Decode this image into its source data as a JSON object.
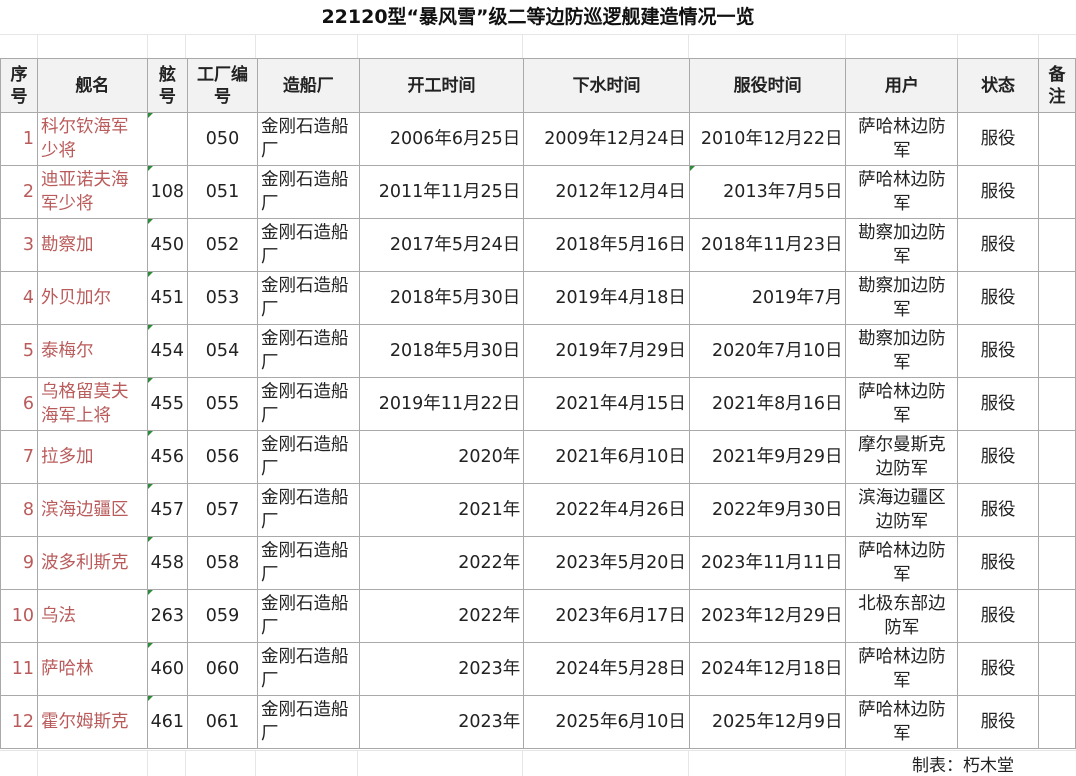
{
  "title": "22120型“暴风雪”级二等边防巡逻舰建造情况一览",
  "columns": [
    "序号",
    "舰名",
    "舷号",
    "工厂编号",
    "造船厂",
    "开工时间",
    "下水时间",
    "服役时间",
    "用户",
    "状态",
    "备注"
  ],
  "rows": [
    {
      "idx": "1",
      "name": "科尔钦海军少将",
      "hull": "",
      "factory": "050",
      "yard": "金刚石造船厂",
      "laid": "2006年6月25日",
      "launched": "2009年12月24日",
      "commissioned": "2010年12月22日",
      "user": "萨哈林边防军",
      "status": "服役",
      "note": ""
    },
    {
      "idx": "2",
      "name": "迪亚诺夫海军少将",
      "hull": "108",
      "factory": "051",
      "yard": "金刚石造船厂",
      "laid": "2011年11月25日",
      "launched": "2012年12月4日",
      "commissioned": "2013年7月5日",
      "user": "萨哈林边防军",
      "status": "服役",
      "note": ""
    },
    {
      "idx": "3",
      "name": "勘察加",
      "hull": "450",
      "factory": "052",
      "yard": "金刚石造船厂",
      "laid": "2017年5月24日",
      "launched": "2018年5月16日",
      "commissioned": "2018年11月23日",
      "user": "勘察加边防军",
      "status": "服役",
      "note": ""
    },
    {
      "idx": "4",
      "name": "外贝加尔",
      "hull": "451",
      "factory": "053",
      "yard": "金刚石造船厂",
      "laid": "2018年5月30日",
      "launched": "2019年4月18日",
      "commissioned": "2019年7月",
      "user": "勘察加边防军",
      "status": "服役",
      "note": ""
    },
    {
      "idx": "5",
      "name": "泰梅尔",
      "hull": "454",
      "factory": "054",
      "yard": "金刚石造船厂",
      "laid": "2018年5月30日",
      "launched": "2019年7月29日",
      "commissioned": "2020年7月10日",
      "user": "勘察加边防军",
      "status": "服役",
      "note": ""
    },
    {
      "idx": "6",
      "name": "乌格留莫夫海军上将",
      "hull": "455",
      "factory": "055",
      "yard": "金刚石造船厂",
      "laid": "2019年11月22日",
      "launched": "2021年4月15日",
      "commissioned": "2021年8月16日",
      "user": "萨哈林边防军",
      "status": "服役",
      "note": ""
    },
    {
      "idx": "7",
      "name": "拉多加",
      "hull": "456",
      "factory": "056",
      "yard": "金刚石造船厂",
      "laid": "2020年",
      "launched": "2021年6月10日",
      "commissioned": "2021年9月29日",
      "user": "摩尔曼斯克边防军",
      "status": "服役",
      "note": ""
    },
    {
      "idx": "8",
      "name": "滨海边疆区",
      "hull": "457",
      "factory": "057",
      "yard": "金刚石造船厂",
      "laid": "2021年",
      "launched": "2022年4月26日",
      "commissioned": "2022年9月30日",
      "user": "滨海边疆区边防军",
      "status": "服役",
      "note": ""
    },
    {
      "idx": "9",
      "name": "波多利斯克",
      "hull": "458",
      "factory": "058",
      "yard": "金刚石造船厂",
      "laid": "2022年",
      "launched": "2023年5月20日",
      "commissioned": "2023年11月11日",
      "user": "萨哈林边防军",
      "status": "服役",
      "note": ""
    },
    {
      "idx": "10",
      "name": "乌法",
      "hull": "263",
      "factory": "059",
      "yard": "金刚石造船厂",
      "laid": "2022年",
      "launched": "2023年6月17日",
      "commissioned": "2023年12月29日",
      "user": "北极东部边防军",
      "status": "服役",
      "note": ""
    },
    {
      "idx": "11",
      "name": "萨哈林",
      "hull": "460",
      "factory": "060",
      "yard": "金刚石造船厂",
      "laid": "2023年",
      "launched": "2024年5月28日",
      "commissioned": "2024年12月18日",
      "user": "萨哈林边防军",
      "status": "服役",
      "note": ""
    },
    {
      "idx": "12",
      "name": "霍尔姆斯克",
      "hull": "461",
      "factory": "061",
      "yard": "金刚石造船厂",
      "laid": "2023年",
      "launched": "2025年6月10日",
      "commissioned": "2025年12月9日",
      "user": "萨哈林边防军",
      "status": "服役",
      "note": ""
    }
  ],
  "credit": "制表：朽木堂",
  "colors": {
    "link": "#ba5b5b",
    "border": "#a9a9a9",
    "header_bg": "#f2f2f2",
    "comment_marker": "#2e8b3c"
  }
}
